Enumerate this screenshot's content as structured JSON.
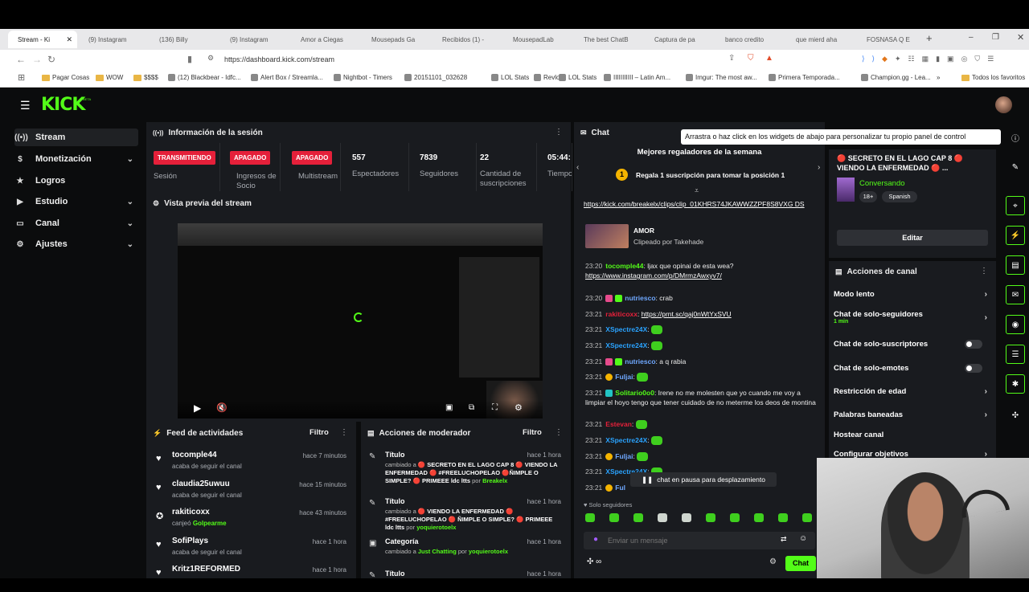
{
  "browser": {
    "tabs": [
      {
        "label": "Stream - Ki",
        "color": "#53fc18",
        "active": true
      },
      {
        "label": "(9) Instagram",
        "color": "#d62976"
      },
      {
        "label": "(136) Billy",
        "color": "#ff0000"
      },
      {
        "label": "(9) Instagram",
        "color": "#d62976"
      },
      {
        "label": "Amor a Ciegas",
        "color": "#d6296d"
      },
      {
        "label": "Mousepads Ga",
        "color": "#2b2d73"
      },
      {
        "label": "Recibidos (1) -",
        "color": "#ea4335"
      },
      {
        "label": "MousepadLab",
        "color": "#6b6b6b"
      },
      {
        "label": "The best ChatB",
        "color": "#222222"
      },
      {
        "label": "Captura de pa",
        "color": "#7a5cff"
      },
      {
        "label": "banco credito",
        "color": "#4285f4"
      },
      {
        "label": "que mierd aha",
        "color": "#4285f4"
      },
      {
        "label": "FOSNASA Q E",
        "color": "#4285f4"
      }
    ],
    "new_tab": "+",
    "url": "https://dashboard.kick.com/stream",
    "bookmarks": [
      {
        "label": "Pagar Cosas",
        "kind": "folder"
      },
      {
        "label": "WOW",
        "kind": "folder"
      },
      {
        "label": "$$$$",
        "kind": "folder"
      },
      {
        "label": "(12) Blackbear - Idfc...",
        "kind": "site"
      },
      {
        "label": "Alert Box / Streamla...",
        "kind": "site"
      },
      {
        "label": "Nightbot - Timers",
        "kind": "site"
      },
      {
        "label": "20151101_032628",
        "kind": "site"
      },
      {
        "label": "LOL Stats",
        "kind": "site"
      },
      {
        "label": "Revlo",
        "kind": "site"
      },
      {
        "label": "LOL Stats",
        "kind": "site"
      },
      {
        "label": "IIIIIIIIIII – Latin Am...",
        "kind": "site"
      },
      {
        "label": "Imgur: The most aw...",
        "kind": "site"
      },
      {
        "label": "Primera Temporada...",
        "kind": "site"
      },
      {
        "label": "Champion.gg - Lea...",
        "kind": "site"
      },
      {
        "label": "»",
        "kind": "more"
      },
      {
        "label": "Todos los favoritos",
        "kind": "folder"
      }
    ]
  },
  "kick": {
    "logo": "KICK",
    "logo_sup": "BETA",
    "sidebar": [
      {
        "label": "Stream",
        "icon": "broadcast-icon",
        "glyph": "((•))",
        "active": true
      },
      {
        "label": "Monetización",
        "icon": "dollar-icon",
        "glyph": "$",
        "chevron": true
      },
      {
        "label": "Logros",
        "icon": "trophy-icon",
        "glyph": "★"
      },
      {
        "label": "Estudio",
        "icon": "video-icon",
        "glyph": "▶",
        "chevron": true
      },
      {
        "label": "Canal",
        "icon": "display-icon",
        "glyph": "▭",
        "chevron": true
      },
      {
        "label": "Ajustes",
        "icon": "gear-icon",
        "glyph": "⚙",
        "chevron": true
      }
    ],
    "session": {
      "title": "Información de la sesión",
      "badges": [
        {
          "value": "TRANSMITIENDO",
          "label": "Sesión"
        },
        {
          "value": "APAGADO",
          "label": "Ingresos de Socio"
        },
        {
          "value": "APAGADO",
          "label": "Multistream"
        }
      ],
      "stats": [
        {
          "value": "557",
          "label": "Espectadores"
        },
        {
          "value": "7839",
          "label": "Seguidores"
        },
        {
          "value": "22",
          "label": "Cantidad de suscripciones"
        },
        {
          "value": "05:44:",
          "label": "Tiempo en vivo"
        }
      ]
    },
    "preview": {
      "title": "Vista previa del stream"
    },
    "feed": {
      "title": "Feed de actividades",
      "filter": "Filtro",
      "items": [
        {
          "name": "tocomple44",
          "sub": "acaba de seguir el canal",
          "time": "hace 7 minutos",
          "icon": "heart-icon"
        },
        {
          "name": "claudia25uwuu",
          "sub": "acaba de seguir el canal",
          "time": "hace 15 minutos",
          "icon": "heart-icon"
        },
        {
          "name": "rakiticoxx",
          "sub": "canjeó",
          "sub_green": "Golpearme",
          "time": "hace 43 minutos",
          "icon": "reward-icon"
        },
        {
          "name": "SofiPlays",
          "sub": "acaba de seguir el canal",
          "time": "hace 1 hora",
          "icon": "heart-icon"
        },
        {
          "name": "Kritz1REFORMED",
          "sub": "",
          "time": "hace 1 hora",
          "icon": "heart-icon"
        }
      ]
    },
    "mod": {
      "title": "Acciones de moderador",
      "filter": "Filtro",
      "items": [
        {
          "title": "Título",
          "time": "hace 1 hora",
          "prefix": "cambiado a",
          "text": "🔴 SECRETO EN EL LAGO CAP 8 🔴 VIENDO LA ENFERMEDAD 🔴 #FREELUCHOPELAO 🔴ÑIMPLE O SIMPLE? 🔴 PRIMEEE ldc ltts",
          "by": "por",
          "user": "Breakelx"
        },
        {
          "title": "Título",
          "time": "hace 1 hora",
          "prefix": "cambiado a",
          "text": "🔴 VIENDO LA ENFERMEDAD 🔴 #FREELUCHOPELAO 🔴 ÑIMPLE O SIMPLE? 🔴 PRIMEEE ldc ltts",
          "by": "por",
          "user": "yoquierotoelx"
        },
        {
          "title": "Categoría",
          "time": "hace 1 hora",
          "prefix": "cambiado a",
          "text": "Just Chatting",
          "by": "por",
          "user": "yoquierotoelx"
        },
        {
          "title": "Título",
          "time": "hace 1 hora"
        }
      ]
    },
    "chat": {
      "title": "Chat",
      "gifters_title": "Mejores regaladores de la semana",
      "gifters_rank": "1",
      "gifters_cta": "Regala 1 suscripción para tomar la posición 1",
      "clip_url": "https://kick.com/breakelx/clips/clip_01KHRS74JKAWWZZPF8S8VXG DS",
      "clip_title": "AMOR",
      "clip_by": "Clipeado por Takehade",
      "messages": [
        {
          "ts": "23:20",
          "user": "tocomple44",
          "color": "#53fc18",
          "text": ": ljax que opinai de esta wea?",
          "link": "https://www.instagram.com/p/DMrmzAwxyv7/"
        },
        {
          "ts": "23:20",
          "user": "nutriesco",
          "color": "#6fa8ff",
          "text": ": crab",
          "badges": "pink,green"
        },
        {
          "ts": "23:21",
          "user": "rakiticoxx",
          "color": "#e5203a",
          "text": ": ",
          "link": "https://prnt.sc/qaj0nWtYxSVU"
        },
        {
          "ts": "23:21",
          "user": "XSpectre24X",
          "color": "#2aa3ff",
          "text": ": ",
          "emote": true
        },
        {
          "ts": "23:21",
          "user": "XSpectre24X",
          "color": "#2aa3ff",
          "text": ": ",
          "emote": true
        },
        {
          "ts": "23:21",
          "user": "nutriesco",
          "color": "#6fa8ff",
          "text": ": a q rabia",
          "badges": "pink,green"
        },
        {
          "ts": "23:21",
          "user": "Fuljai",
          "color": "#6fa8ff",
          "text": ": ",
          "emote": true,
          "badges": "gold"
        },
        {
          "ts": "23:21",
          "user": "Solitario0o0",
          "color": "#53fc18",
          "text": ": Irene no me molesten que yo cuando me voy a limpiar el hoyo tengo que tener cuidado de no meterme los deos de montina",
          "badges": "teal"
        },
        {
          "ts": "23:21",
          "user": "Estevan",
          "color": "#e5203a",
          "text": ": ",
          "emote": true
        },
        {
          "ts": "23:21",
          "user": "XSpectre24X",
          "color": "#2aa3ff",
          "text": ": ",
          "emote": true
        },
        {
          "ts": "23:21",
          "user": "Fuljai",
          "color": "#6fa8ff",
          "text": ": ",
          "emote": true,
          "badges": "gold"
        },
        {
          "ts": "23:21",
          "user": "XSpectre24X",
          "color": "#2aa3ff",
          "text": ": ",
          "emote": true
        },
        {
          "ts": "23:21",
          "user": "Ful",
          "color": "#6fa8ff",
          "text": "",
          "badges": "gold"
        }
      ],
      "paused": "chat en pausa para desplazamiento",
      "mode": "Solo seguidores",
      "input_placeholder": "Enviar un mensaje",
      "send": "Chat"
    },
    "tooltip": "Arrastra o haz click en los widgets de abajo para personalizar tu propio panel de control",
    "stream_info": {
      "title": "🔴 SECRETO EN EL LAGO CAP 8 🔴 VIENDO LA ENFERMEDAD 🔴 ...",
      "category": "Conversando",
      "tags": [
        "18+",
        "Spanish"
      ],
      "edit": "Editar"
    },
    "channel_actions": {
      "title": "Acciones de canal",
      "items": [
        {
          "label": "Modo lento",
          "type": "arrow"
        },
        {
          "label": "Chat de solo-seguidores",
          "sub": "1 min",
          "type": "arrow"
        },
        {
          "label": "Chat de solo-suscriptores",
          "type": "toggle"
        },
        {
          "label": "Chat de solo-emotes",
          "type": "toggle"
        },
        {
          "label": "Restricción de edad",
          "type": "arrow"
        },
        {
          "label": "Palabras baneadas",
          "type": "arrow"
        },
        {
          "label": "Hostear canal",
          "type": "none"
        },
        {
          "label": "Configurar objetivos",
          "type": "arrow"
        }
      ]
    },
    "rightbar": [
      {
        "icon": "pencil-icon",
        "glyph": "✎"
      },
      {
        "icon": "scan-icon",
        "glyph": "⌖"
      },
      {
        "icon": "bolt-icon",
        "glyph": "⚡"
      },
      {
        "icon": "document-icon",
        "glyph": "▤"
      },
      {
        "icon": "chat-bubble-icon",
        "glyph": "✉"
      },
      {
        "icon": "broadcast-icon",
        "glyph": "◉"
      },
      {
        "icon": "list-icon",
        "glyph": "☰"
      },
      {
        "icon": "wrench-icon",
        "glyph": "✱"
      },
      {
        "icon": "grid-icon",
        "glyph": "✣"
      }
    ]
  }
}
